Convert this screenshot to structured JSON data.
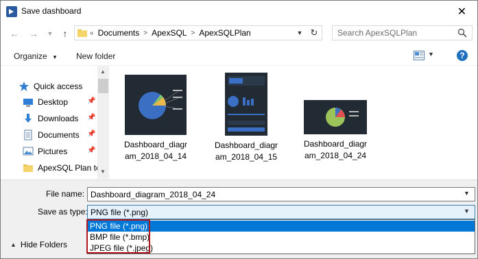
{
  "window": {
    "title": "Save dashboard"
  },
  "address": {
    "overflow": "«",
    "crumbs": [
      "Documents",
      "ApexSQL",
      "ApexSQLPlan"
    ],
    "separator": ">"
  },
  "search": {
    "placeholder": "Search ApexSQLPlan"
  },
  "toolbar": {
    "organize": "Organize",
    "new_folder": "New folder",
    "help": "?"
  },
  "nav": {
    "items": [
      {
        "label": "Quick access",
        "icon": "star-icon"
      },
      {
        "label": "Desktop",
        "icon": "desktop-icon",
        "pinned": true
      },
      {
        "label": "Downloads",
        "icon": "download-arrow-icon",
        "pinned": true
      },
      {
        "label": "Documents",
        "icon": "document-icon",
        "pinned": true
      },
      {
        "label": "Pictures",
        "icon": "pictures-icon",
        "pinned": true
      },
      {
        "label": "ApexSQL Plan te",
        "icon": "folder-icon"
      }
    ]
  },
  "files": [
    {
      "line1": "Dashboard_diagr",
      "line2": "am_2018_04_14"
    },
    {
      "line1": "Dashboard_diagr",
      "line2": "am_2018_04_15"
    },
    {
      "line1": "Dashboard_diagr",
      "line2": "am_2018_04_24"
    }
  ],
  "form": {
    "file_name_label": "File name:",
    "file_name_value": "Dashboard_diagram_2018_04_24",
    "save_type_label": "Save as type:",
    "save_type_value": "PNG file (*.png)",
    "type_options": [
      "PNG file (*.png)",
      "BMP file (*.bmp)",
      "JPEG file (*.jpeg)"
    ],
    "selected_option_index": 0
  },
  "footer": {
    "hide_folders": "Hide Folders"
  },
  "colors": {
    "accent": "#0078d7",
    "highlight_border": "#b0171f",
    "thumb_bg": "#222a33"
  }
}
